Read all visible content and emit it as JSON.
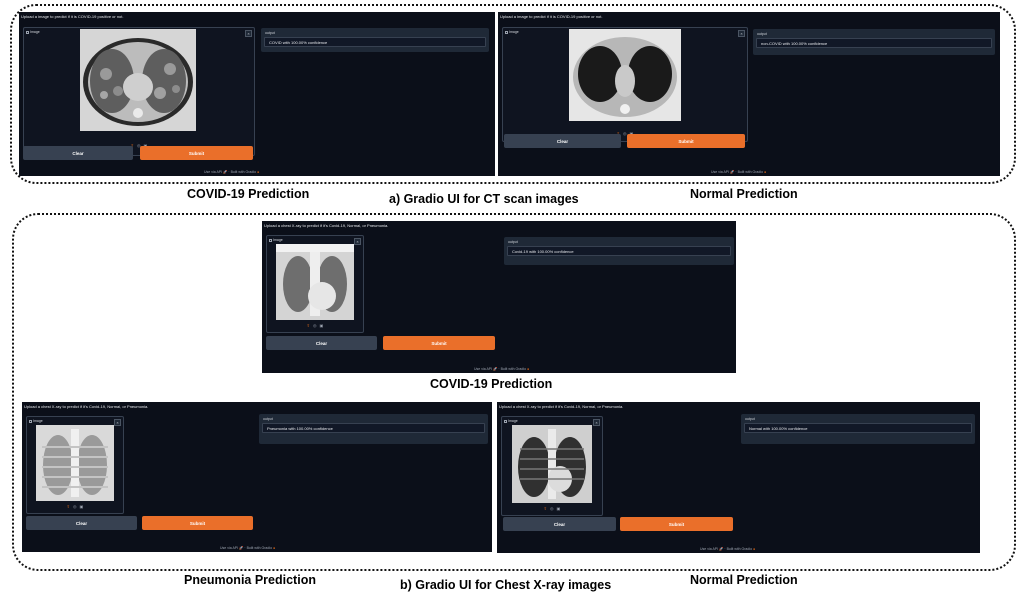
{
  "captions": {
    "ct_left": "COVID-19 Prediction",
    "ct_section": "a) Gradio UI for CT scan images",
    "ct_right": "Normal Prediction",
    "xray_top": "COVID-19 Prediction",
    "xray_left": "Pneumonia Prediction",
    "xray_section": "b) Gradio UI for Chest X-ray images",
    "xray_right": "Normal Prediction"
  },
  "common": {
    "image_label": "Image",
    "output_label": "output",
    "clear_label": "Clear",
    "submit_label": "Submit",
    "api_link": "Use via API",
    "built_with": "Built with Gradio",
    "close_icon": "×",
    "api_icon": "rocket-icon",
    "gradio_icon": "gradio-logo-icon"
  },
  "panels": {
    "ct_covid": {
      "description": "Upload a image to predict if it is COVID-19 positive or not.",
      "output_value": "COVID with 100.00% confidence"
    },
    "ct_normal": {
      "description": "Upload a image to predict if it is COVID-19 positive or not.",
      "output_value": "non-COVID with 100.00% confidence"
    },
    "xray_covid": {
      "description": "Upload a chest X-ray to predict if it's Covid-19, Normal, or Pneumonia.",
      "output_value": "Covid-19 with 100.00% confidence"
    },
    "xray_pneumonia": {
      "description": "Upload a chest X-ray to predict if it's Covid-19, Normal, or Pneumonia.",
      "output_value": "Pneumonia with 100.00% confidence"
    },
    "xray_normal": {
      "description": "Upload a chest X-ray to predict if it's Covid-19, Normal, or Pneumonia.",
      "output_value": "Normal with 100.00% confidence"
    }
  },
  "colors": {
    "panel_bg": "#0b0f19",
    "submit": "#ea6f2a",
    "clear": "#374151"
  }
}
